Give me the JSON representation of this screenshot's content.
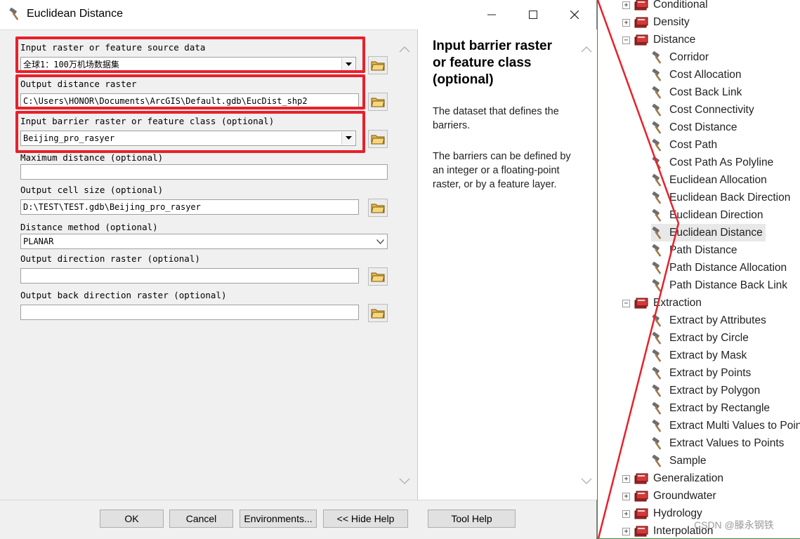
{
  "window": {
    "title": "Euclidean Distance"
  },
  "params": [
    {
      "label": "Input raster or feature source data",
      "value": "全球1：100万机场数据集",
      "kind": "combo"
    },
    {
      "label": "Output distance raster",
      "value": "C:\\Users\\HONOR\\Documents\\ArcGIS\\Default.gdb\\EucDist_shp2",
      "kind": "text"
    },
    {
      "label": "Input barrier raster or feature class (optional)",
      "value": "Beijing_pro_rasyer",
      "kind": "combo"
    },
    {
      "label": "Maximum distance (optional)",
      "value": "",
      "kind": "text"
    },
    {
      "label": "Output cell size (optional)",
      "value": "D:\\TEST\\TEST.gdb\\Beijing_pro_rasyer",
      "kind": "text"
    },
    {
      "label": "Distance method (optional)",
      "value": "PLANAR",
      "kind": "select"
    },
    {
      "label": "Output direction raster (optional)",
      "value": "",
      "kind": "text"
    },
    {
      "label": "Output back direction raster (optional)",
      "value": "",
      "kind": "text"
    }
  ],
  "help": {
    "title": "Input barrier raster or feature class (optional)",
    "p1": "The dataset that defines the barriers.",
    "p2": "The barriers can be defined by an integer or a floating-point raster, or by a feature layer."
  },
  "buttons": {
    "ok": "OK",
    "cancel": "Cancel",
    "environments": "Environments...",
    "hide_help": "<< Hide Help",
    "tool_help": "Tool Help"
  },
  "tree": [
    {
      "label": "Conditional",
      "type": "toolset",
      "state": "collapsed"
    },
    {
      "label": "Density",
      "type": "toolset",
      "state": "collapsed"
    },
    {
      "label": "Distance",
      "type": "toolset",
      "state": "expanded"
    },
    {
      "label": "Corridor",
      "type": "tool"
    },
    {
      "label": "Cost Allocation",
      "type": "tool"
    },
    {
      "label": "Cost Back Link",
      "type": "tool"
    },
    {
      "label": "Cost Connectivity",
      "type": "tool"
    },
    {
      "label": "Cost Distance",
      "type": "tool"
    },
    {
      "label": "Cost Path",
      "type": "tool"
    },
    {
      "label": "Cost Path As Polyline",
      "type": "tool"
    },
    {
      "label": "Euclidean Allocation",
      "type": "tool"
    },
    {
      "label": "Euclidean Back Direction",
      "type": "tool"
    },
    {
      "label": "Euclidean Direction",
      "type": "tool"
    },
    {
      "label": "Euclidean Distance",
      "type": "tool",
      "selected": true
    },
    {
      "label": "Path Distance",
      "type": "tool"
    },
    {
      "label": "Path Distance Allocation",
      "type": "tool"
    },
    {
      "label": "Path Distance Back Link",
      "type": "tool"
    },
    {
      "label": "Extraction",
      "type": "toolset",
      "state": "expanded"
    },
    {
      "label": "Extract by Attributes",
      "type": "tool"
    },
    {
      "label": "Extract by Circle",
      "type": "tool"
    },
    {
      "label": "Extract by Mask",
      "type": "tool"
    },
    {
      "label": "Extract by Points",
      "type": "tool"
    },
    {
      "label": "Extract by Polygon",
      "type": "tool"
    },
    {
      "label": "Extract by Rectangle",
      "type": "tool"
    },
    {
      "label": "Extract Multi Values to Points",
      "type": "tool"
    },
    {
      "label": "Extract Values to Points",
      "type": "tool"
    },
    {
      "label": "Sample",
      "type": "tool"
    },
    {
      "label": "Generalization",
      "type": "toolset",
      "state": "collapsed"
    },
    {
      "label": "Groundwater",
      "type": "toolset",
      "state": "collapsed"
    },
    {
      "label": "Hydrology",
      "type": "toolset",
      "state": "collapsed"
    },
    {
      "label": "Interpolation",
      "type": "toolset",
      "state": "collapsed"
    }
  ],
  "watermark": "CSDN @滕永钢铁",
  "colors": {
    "highlight_box": "#e8202a",
    "diagonal_line": "#e8202a"
  }
}
